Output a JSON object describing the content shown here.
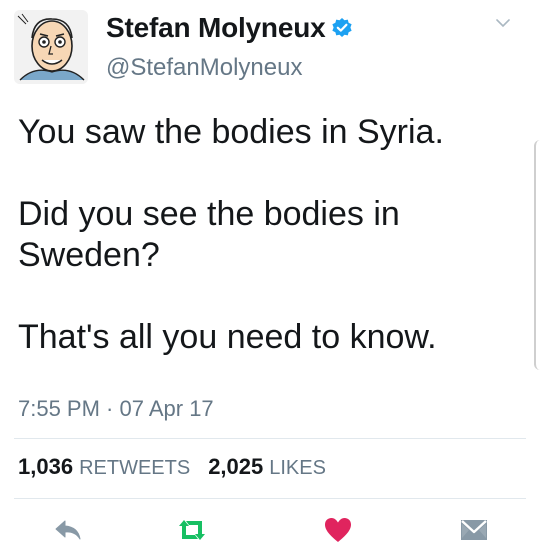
{
  "tweet": {
    "display_name": "Stefan Molyneux",
    "handle": "@StefanMolyneux",
    "verified": true,
    "text_lines": [
      "You saw the bodies in Syria.",
      "",
      "Did you see the bodies in",
      "Sweden?",
      "",
      "That's all you need to know."
    ],
    "timestamp": "7:55 PM · 07 Apr 17"
  },
  "stats": {
    "retweets_count": "1,036",
    "retweets_label": "RETWEETS",
    "likes_count": "2,025",
    "likes_label": "LIKES"
  },
  "actions": {
    "reply_icon": "reply-icon",
    "retweet_icon": "retweet-icon",
    "like_icon": "heart-icon",
    "dm_icon": "envelope-icon"
  },
  "colors": {
    "verified_blue": "#1da1f2",
    "retweet_green": "#17bf63",
    "like_red": "#e0245e",
    "secondary_text": "#657786"
  }
}
